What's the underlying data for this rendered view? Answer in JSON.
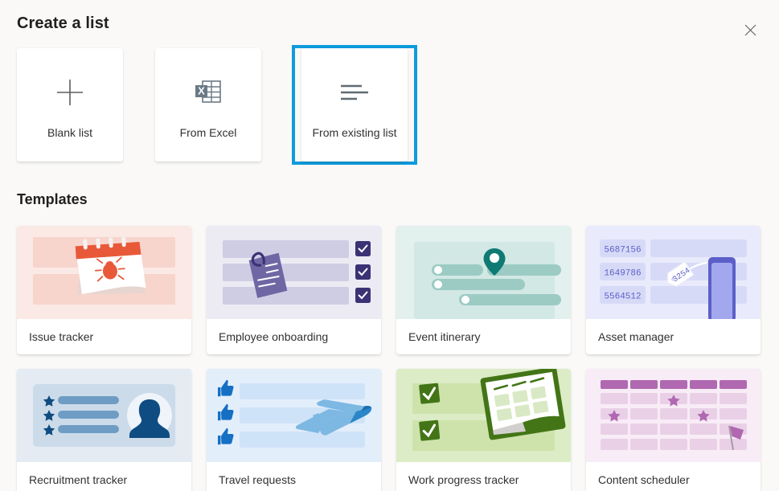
{
  "header": {
    "title": "Create a list",
    "close_icon": "close-icon",
    "close_label": "Close"
  },
  "create_options": [
    {
      "label": "Blank list",
      "icon": "plus-icon",
      "focused": false
    },
    {
      "label": "From Excel",
      "icon": "excel-grid-icon",
      "focused": false
    },
    {
      "label": "From existing list",
      "icon": "list-lines-icon",
      "focused": true
    }
  ],
  "templates_section": {
    "title": "Templates"
  },
  "templates": [
    {
      "name": "Issue tracker",
      "art": "calendar-bug",
      "bg": "#fbe9e5",
      "panel": "#f7d9d2"
    },
    {
      "name": "Employee onboarding",
      "art": "clipboard-checks",
      "bg": "#e9e8f2",
      "panel": "#cecde4"
    },
    {
      "name": "Event itinerary",
      "art": "map-pin-timeline",
      "bg": "#e0f0ee",
      "panel": "#c7e2dd"
    },
    {
      "name": "Asset manager",
      "art": "asset-rows-phone",
      "bg": "#e8e9fa",
      "panel": "#d7daf7",
      "rows": [
        "5687156",
        "1649786",
        "5564512"
      ],
      "tag": "3254"
    },
    {
      "name": "Recruitment tracker",
      "art": "id-badge-avatar",
      "bg": "#e3eaf2",
      "panel": "#ccdbe9"
    },
    {
      "name": "Travel requests",
      "art": "thumbs-airplane",
      "bg": "#e2eefb",
      "panel": "#d2e5f8"
    },
    {
      "name": "Work progress tracker",
      "art": "checks-calendar",
      "bg": "#dfeccc",
      "panel": "#cfe2b6"
    },
    {
      "name": "Content scheduler",
      "art": "calendar-grid-flag",
      "bg": "#f7eaf5",
      "panel": "#efd9ec"
    }
  ],
  "colors": {
    "page_background": "#faf9f8",
    "card_background": "#ffffff",
    "focus_ring": "#0f9bdc",
    "text_primary": "#201f1e",
    "text_secondary": "#323130",
    "icon_gray": "#605e5c"
  }
}
